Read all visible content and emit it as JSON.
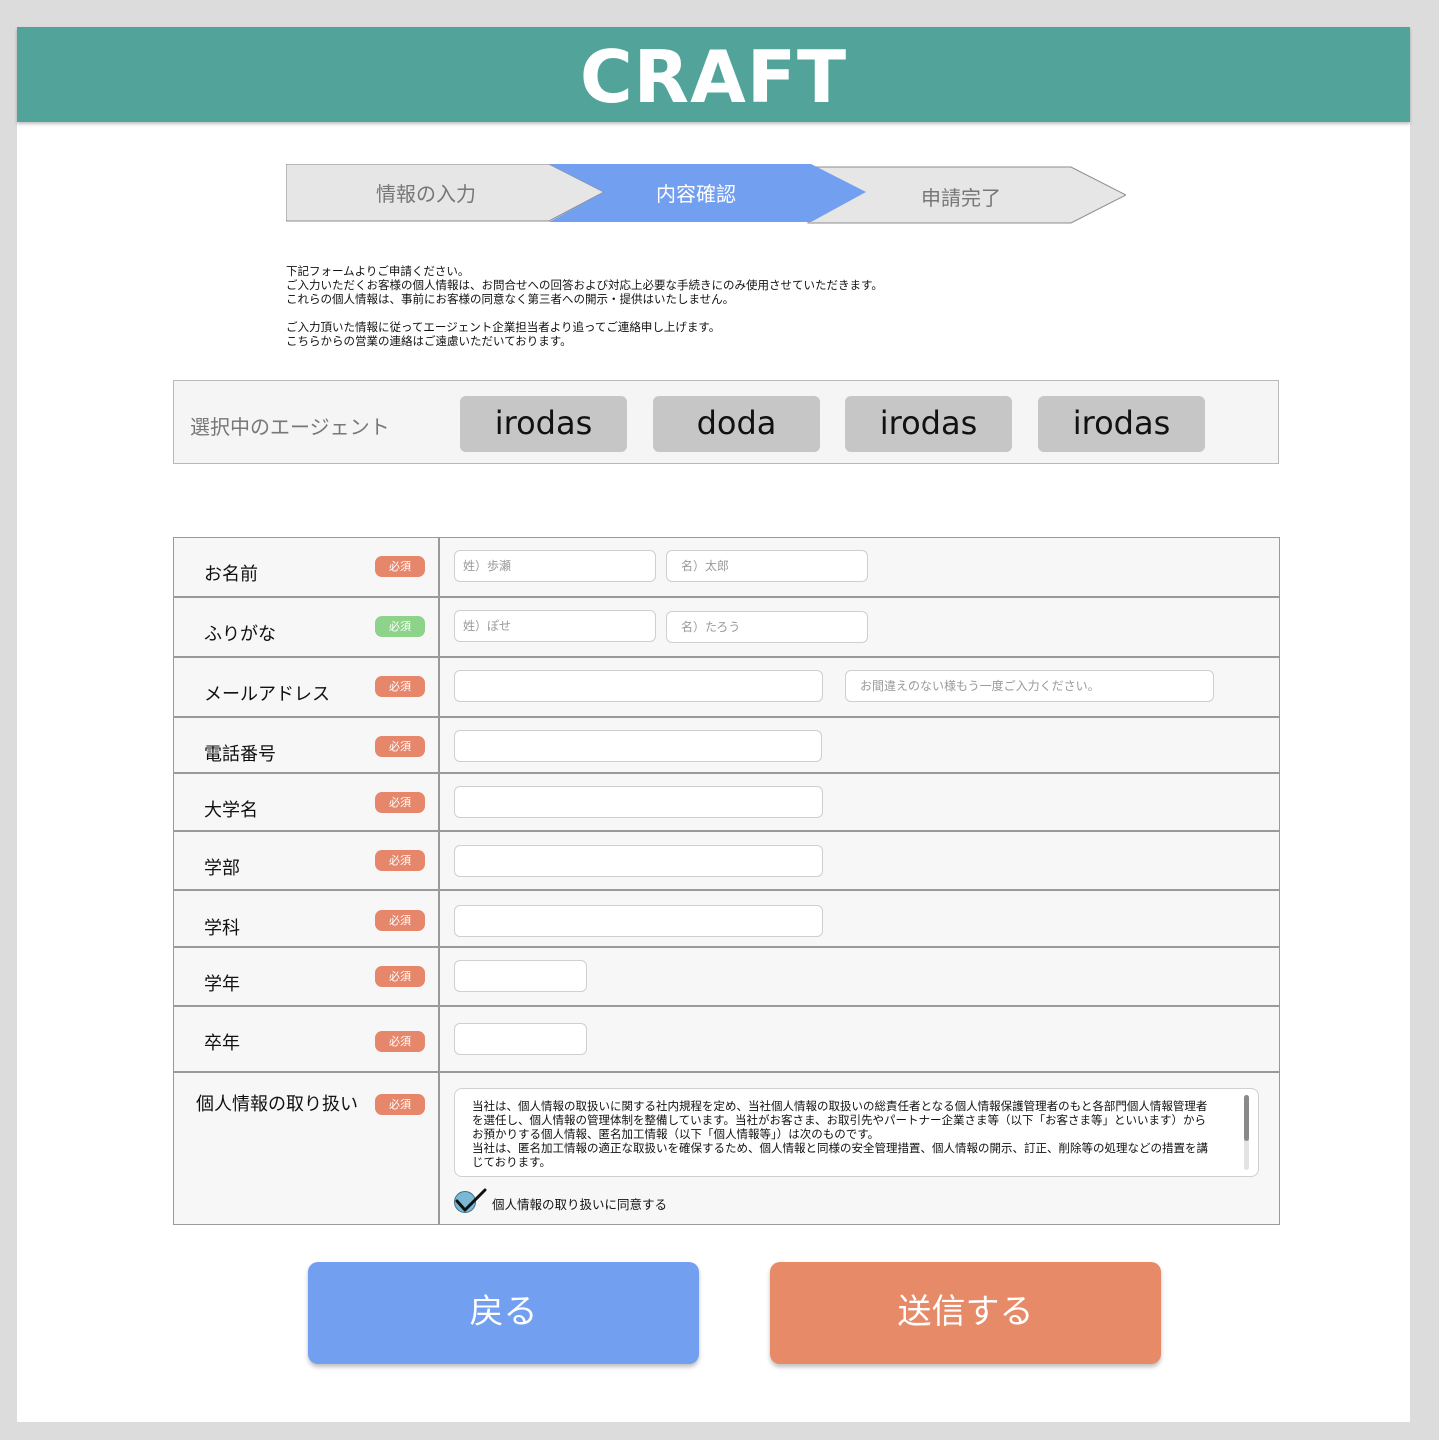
{
  "header": {
    "logo": "CRAFT"
  },
  "steps": [
    {
      "label": "情報の入力",
      "state": "done"
    },
    {
      "label": "内容確認",
      "state": "active"
    },
    {
      "label": "申請完了",
      "state": "pending"
    }
  ],
  "notice": {
    "lines": [
      "下記フォームよりご申請ください。",
      "ご入力いただくお客様の個人情報は、お問合せへの回答および対応上必要な手続きにのみ使用させていただきます。",
      "これらの個人情報は、事前にお客様の同意なく第三者への開示・提供はいたしません。",
      "ご入力頂いた情報に従ってエージェント企業担当者より追ってご連絡申し上げます。",
      "こちらからの営業の連絡はご遠慮いただいております。"
    ]
  },
  "agents": {
    "label": "選択中のエージェント",
    "items": [
      "irodas",
      "doda",
      "irodas",
      "irodas"
    ]
  },
  "form": {
    "badge": "必須",
    "name": {
      "label": "お名前",
      "last_placeholder": "姓）歩瀬",
      "first_placeholder": "名）太郎"
    },
    "furigana": {
      "label": "ふりがな",
      "last_placeholder": "姓）ぽせ",
      "first_placeholder": "名）たろう"
    },
    "email": {
      "label": "メールアドレス",
      "value": "",
      "confirm_placeholder": "お間違えのない様もう一度ご入力ください。"
    },
    "phone": {
      "label": "電話番号",
      "value": ""
    },
    "university": {
      "label": "大学名",
      "value": ""
    },
    "faculty": {
      "label": "学部",
      "value": ""
    },
    "department": {
      "label": "学科",
      "value": ""
    },
    "grade": {
      "label": "学年",
      "value": ""
    },
    "graduation": {
      "label": "卒年",
      "value": ""
    },
    "privacy": {
      "label": "個人情報の取り扱い",
      "text": [
        "当社は、個人情報の取扱いに関する社内規程を定め、当社個人情報の取扱いの総責任者となる個人情報保護管理者のもと各部門個人情報管理者を選任し、個人情報の管理体制を整備しています。当社がお客さま、お取引先やパートナー企業さま等（以下「お客さま等」といいます）からお預かりする個人情報、匿名加工情報（以下「個人情報等」）は次のものです。",
        "当社は、匿名加工情報の適正な取扱いを確保するため、個人情報と同様の安全管理措置、個人情報の開示、訂正、削除等の処理などの措置を講じております。"
      ],
      "agree_label": "個人情報の取り扱いに同意する",
      "agreed": true
    }
  },
  "buttons": {
    "back": "戻る",
    "submit": "送信する"
  },
  "colors": {
    "header": "#52a49a",
    "step_active": "#729ff0",
    "badge_required": "#e6866a",
    "badge_green": "#8ed38a",
    "back_button": "#729ff0",
    "submit_button": "#e78a68"
  }
}
